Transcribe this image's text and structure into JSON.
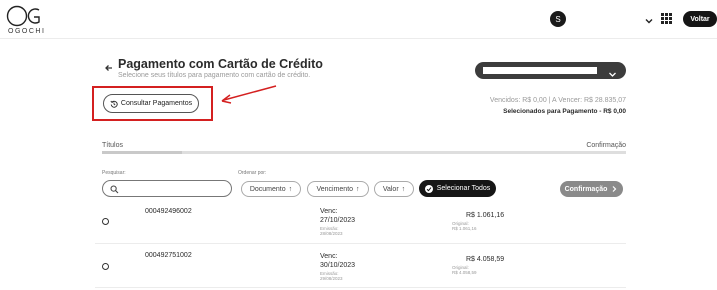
{
  "header": {
    "logo_text": "OGOCHI",
    "avatar_initial": "S",
    "back_button_label": "Voltar"
  },
  "page": {
    "title": "Pagamento com Cartão de Crédito",
    "subtitle": "Selecione seus títulos para pagamento com cartão de crédito."
  },
  "company_select": {
    "chevron_icon": "chevron-down-icon"
  },
  "consultar_button": {
    "label": "Consultar Pagamentos",
    "icon": "history-icon"
  },
  "annotation": {
    "highlight_color": "#d42020"
  },
  "totals": {
    "summary": "Vencidos: R$ 0,00 | A Vencer: R$ 28.835,07",
    "selected": "Selecionados para Pagamento - R$ 0,00"
  },
  "steps": {
    "step1": "Títulos",
    "step2": "Confirmação"
  },
  "filters": {
    "search_label": "Pesquisar:",
    "search_value": "",
    "order_label": "Ordenar por:",
    "order_document": "Documento",
    "order_due": "Vencimento",
    "order_value": "Valor",
    "select_all": "Selecionar Todos",
    "confirm": "Confirmação"
  },
  "rows": [
    {
      "document": "000492496002",
      "due_label": "Venc:",
      "due_date": "27/10/2023",
      "issue_label": "Emissão:",
      "issue_date": "28/08/2023",
      "amount": "R$ 1.061,16",
      "original_label": "Original:",
      "original_value": "R$ 1.061,16"
    },
    {
      "document": "000492751002",
      "due_label": "Venc:",
      "due_date": "30/10/2023",
      "issue_label": "Emissão:",
      "issue_date": "29/08/2023",
      "amount": "R$ 4.058,59",
      "original_label": "Original:",
      "original_value": "R$ 4.058,59"
    }
  ]
}
